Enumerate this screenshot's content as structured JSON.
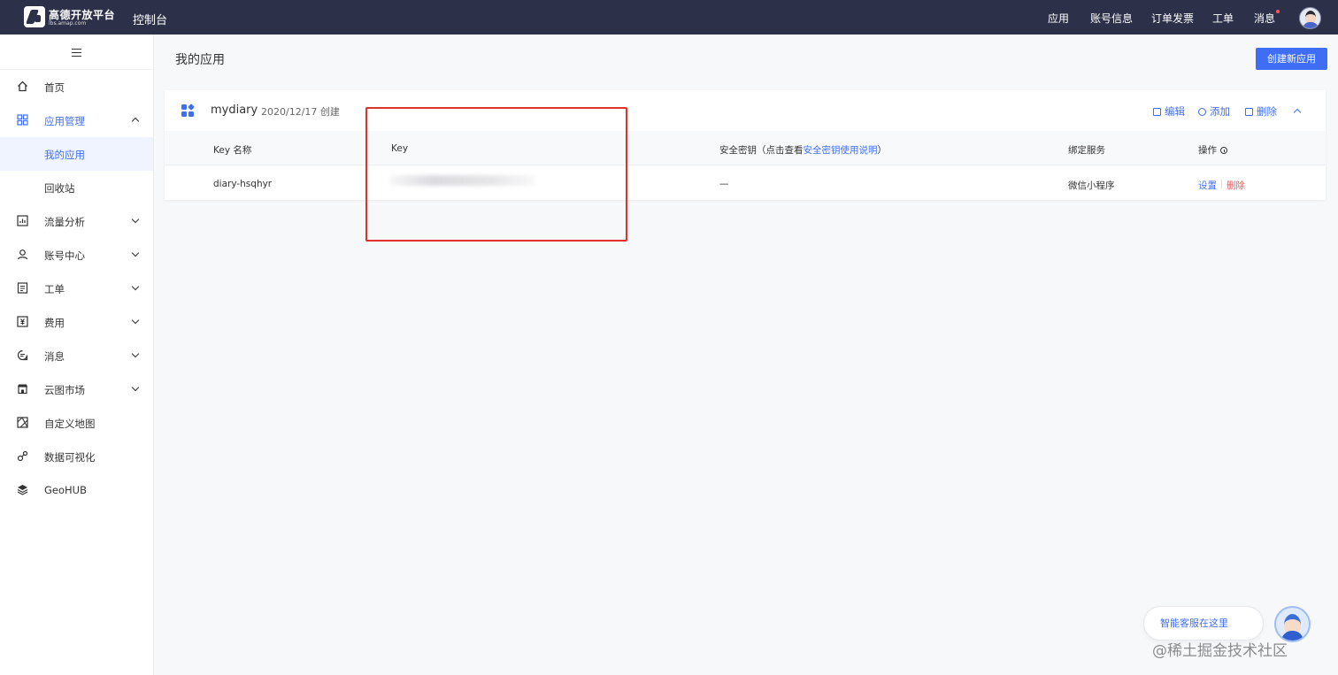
{
  "topbar": {
    "logo_title": "高德开放平台",
    "logo_sub": "lbs.amap.com",
    "console_title": "控制台",
    "nav": {
      "app": "应用",
      "account": "账号信息",
      "orders": "订单发票",
      "ticket": "工单",
      "messages": "消息"
    },
    "message_badge_color": "#ff5555",
    "avatar_icon": "user-avatar"
  },
  "sidebar": {
    "toggle_icon": "hamburger-icon",
    "items": [
      {
        "label": "首页",
        "icon": "home-icon"
      },
      {
        "label": "应用管理",
        "icon": "grid-icon",
        "expanded": true
      },
      {
        "label": "我的应用",
        "active": true
      },
      {
        "label": "回收站"
      },
      {
        "label": "流量分析",
        "icon": "chart-icon"
      },
      {
        "label": "账号中心",
        "icon": "user-icon"
      },
      {
        "label": "工单",
        "icon": "ticket-icon"
      },
      {
        "label": "费用",
        "icon": "billing-icon"
      },
      {
        "label": "消息",
        "icon": "message-icon"
      },
      {
        "label": "云图市场",
        "icon": "store-icon"
      },
      {
        "label": "自定义地图",
        "icon": "map-icon"
      },
      {
        "label": "数据可视化",
        "icon": "visualization-icon"
      },
      {
        "label": "GeoHUB",
        "icon": "layers-icon"
      }
    ]
  },
  "main": {
    "title": "我的应用",
    "create_button": "创建新应用",
    "app": {
      "name": "mydiary",
      "created": "2020/12/17 创建",
      "actions": {
        "edit": "编辑",
        "add": "添加",
        "delete": "删除"
      },
      "table": {
        "headers": {
          "key_name": "Key 名称",
          "key": "Key",
          "secret_prefix": "安全密钥（点击查看",
          "secret_link": "安全密钥使用说明",
          "secret_suffix": "）",
          "service": "绑定服务",
          "operation": "操作"
        },
        "rows": [
          {
            "key_name": "diary-hsqhyr",
            "key": "",
            "secret": "—",
            "service": "微信小程序",
            "settings": "设置",
            "delete": "删除"
          }
        ]
      }
    }
  },
  "support": {
    "label": "智能客服在这里",
    "avatar_icon": "support-agent-avatar"
  },
  "watermark": "@稀土掘金技术社区",
  "colors": {
    "topbar_bg": "#2c3049",
    "accent": "#3f6ef4",
    "danger": "#f05454",
    "highlight_box": "#e0312a"
  }
}
